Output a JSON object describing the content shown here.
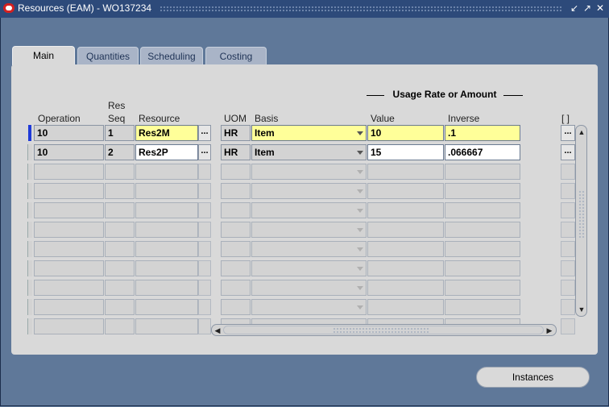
{
  "window": {
    "title": "Resources (EAM) - WO137234"
  },
  "tabs": [
    {
      "label": "Main",
      "active": true
    },
    {
      "label": "Quantities",
      "active": false
    },
    {
      "label": "Scheduling",
      "active": false
    },
    {
      "label": "Costing",
      "active": false
    }
  ],
  "grid": {
    "group_header": "Usage Rate or Amount",
    "headers": {
      "operation": "Operation",
      "res_seq_line1": "Res",
      "res_seq_line2": "Seq",
      "resource": "Resource",
      "uom": "UOM",
      "basis": "Basis",
      "value": "Value",
      "inverse": "Inverse",
      "folder": "[ ]"
    },
    "rows": [
      {
        "operation": "10",
        "res_seq": "1",
        "resource": "Res2M",
        "uom": "HR",
        "basis": "Item",
        "value": "10",
        "inverse": ".1",
        "current": true
      },
      {
        "operation": "10",
        "res_seq": "2",
        "resource": "Res2P",
        "uom": "HR",
        "basis": "Item",
        "value": "15",
        "inverse": ".066667",
        "current": false
      }
    ],
    "empty_rows": 9,
    "lov_glyph": "...",
    "more_glyph": "..."
  },
  "buttons": {
    "instances": "Instances"
  },
  "colors": {
    "titlebar": "#2d4a7a",
    "background": "#5f7899",
    "canvas": "#d9d9d9",
    "current_record": "#ffff99",
    "row_indicator": "#1f3ad8"
  }
}
